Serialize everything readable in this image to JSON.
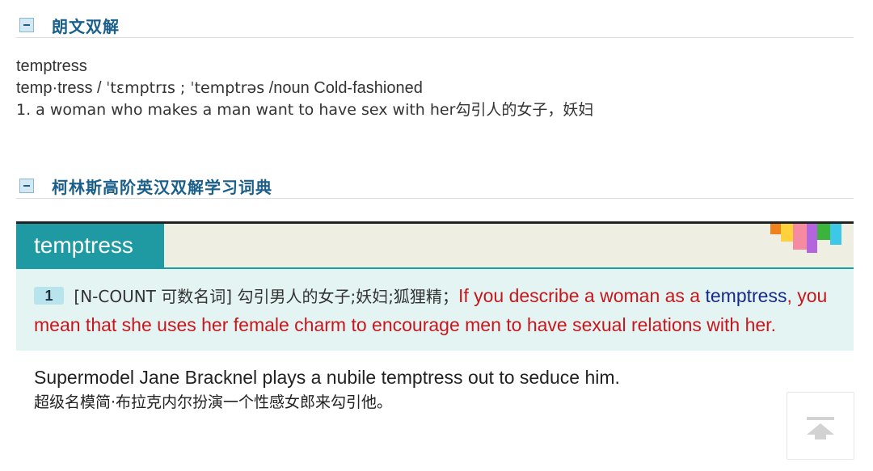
{
  "sections": [
    {
      "title": "朗文双解"
    },
    {
      "title": "柯林斯高阶英汉双解学习词典"
    }
  ],
  "longman": {
    "headword": "temptress",
    "syllables": "temp·tress",
    "sep1": " / ",
    "pron": "ˈtɛmptrɪs ; ˈtemptrəs",
    "pos": " /noun Cold-fashioned",
    "def": "1. a woman who makes a man want to have sex with her勾引人的女子，妖妇"
  },
  "collins": {
    "headword": "temptress",
    "deco_colors": [
      "#f0821e",
      "#ffd23c",
      "#f58aa0",
      "#b464dc",
      "#3cb43c",
      "#3cc8e6"
    ],
    "sense": {
      "number": "1",
      "tag": "[N-COUNT 可数名词]",
      "cn_def": "勾引男人的女子;妖妇;狐狸精；",
      "en_def_pre": "If you describe a woman as a ",
      "en_def_word": "temptress",
      "en_def_post": ", you mean that she uses her female charm to encourage men to have sexual relations with her."
    },
    "example": {
      "en": "Supermodel Jane Bracknel plays a nubile temptress out to seduce him.",
      "cn": "超级名模简·布拉克内尔扮演一个性感女郎来勾引他。"
    }
  },
  "back_to_top": {
    "icon": "arrow-up-to-top-icon"
  }
}
